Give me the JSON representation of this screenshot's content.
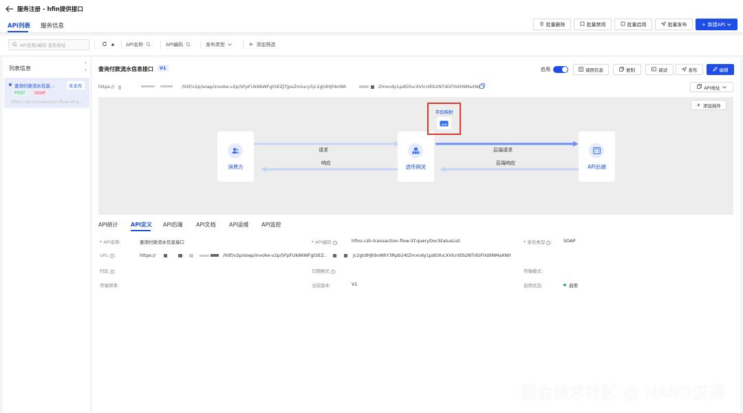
{
  "header": {
    "title": "服务注册 - hfin提供接口"
  },
  "top_tabs": [
    {
      "label": "API列表"
    },
    {
      "label": "服务信息"
    }
  ],
  "toolbar": {
    "batch_delete": "批量删除",
    "batch_disable": "批量禁用",
    "batch_enable": "批量启用",
    "batch_publish": "批量发布",
    "new_api": "新建API"
  },
  "filters": {
    "search_placeholder": "API名称/编码  发布地址",
    "api_name": "API名称",
    "api_code": "API编码",
    "publish_type": "发布类型",
    "add_filter": "添加筛选"
  },
  "sidebar": {
    "title": "列表信息",
    "items": [
      {
        "name": "查询付款流水信息...",
        "status": "未发布",
        "method": "POST",
        "protocol": "SOAP",
        "code": "hfins.csh-transaction-flow-itf.q..."
      }
    ]
  },
  "api": {
    "title": "查询付款流水信息接口",
    "version": "V1",
    "enable_label": "启用",
    "buttons": {
      "call_info": "调用信息",
      "copy": "复制",
      "debug": "调试",
      "publish": "发布",
      "edit": "编辑"
    },
    "url_prefix": "https://",
    "url_path": "/hitf/v2p/soap/invoke-v2p/SFpFUk86WFgtSEZJTjpoZmlucy5jc2gtdHJhbnNh",
    "url_tail": "Zmxvdy1pdGYucXVlcnlEb2NTdGF0dXNMaXN0",
    "api_address_btn": "API地址",
    "add_plugin": "添加插件"
  },
  "flow": {
    "consumer": "消费方",
    "gateway": "透传网关",
    "backend": "API后端",
    "plugin": "字段映射",
    "request": "请求",
    "response": "响应",
    "backend_request": "后端请求",
    "backend_response": "后端响应"
  },
  "detail_tabs": [
    {
      "label": "API统计"
    },
    {
      "label": "API定义"
    },
    {
      "label": "API后端"
    },
    {
      "label": "API文档"
    },
    {
      "label": "API运维"
    },
    {
      "label": "API监控"
    }
  ],
  "fields": {
    "api_name_label": "API名称",
    "api_name_value": "查询付款流水信息接口",
    "api_code_label": "API编码",
    "api_code_value": "hfins.csh-transaction-flow-itf.queryDocStatusList",
    "publish_type_label": "发布类型",
    "publish_type_value": "SOAP",
    "url_label": "URL",
    "url_prefix": "https://",
    "url_mid": "/hitf/v2p/soap/invoke-v2p/SFpFUk86WFgtSEZ..",
    "url_end": "jc2gtdHJhbnNhY3Rpb24tZmxvdy1pdGYucXVlcnlEb2NTdGF0dXNMaXN0",
    "region_label": "时区",
    "date_format_label": "日期格式",
    "transfer_mode_label": "传输模式:",
    "transfer_freq_label": "传输频率:",
    "current_version_label": "当前版本:",
    "current_version_value": "V1",
    "enable_status_label": "启用状态:",
    "enable_status_value": "启用"
  },
  "watermark": "掘金技术社区 @ HAND汉得",
  "colors": {
    "primary": "#1f4ee6",
    "highlight_border": "#d93a2b",
    "post": "#31b16f",
    "soap": "#e83c7c"
  }
}
